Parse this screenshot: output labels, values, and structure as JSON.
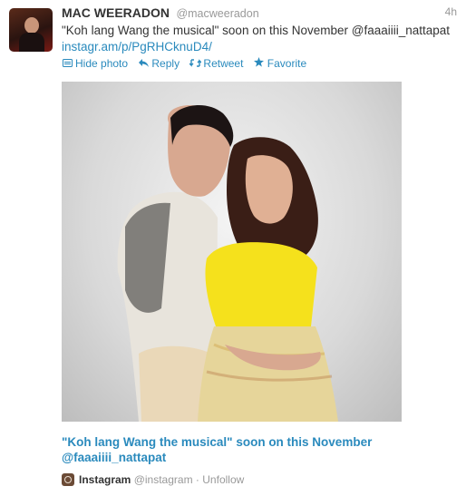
{
  "tweet": {
    "fullname": "MAC WEERADON",
    "username": "@macweeradon",
    "time": "4h",
    "text_prefix": "\"Koh lang Wang the musical\" soon on this November @faaaiiii_nattapat ",
    "text_link": "instagr.am/p/PgRHCknuD4/"
  },
  "actions": {
    "hide_photo": "Hide photo",
    "reply": "Reply",
    "retweet": "Retweet",
    "favorite": "Favorite"
  },
  "media": {
    "caption": "\"Koh lang Wang the musical\" soon on this November @faaaiiii_nattapat"
  },
  "attribution": {
    "name": "Instagram",
    "handle": "@instagram",
    "separator": "·",
    "unfollow": "Unfollow"
  },
  "colors": {
    "link": "#2a8abd",
    "muted": "#999999",
    "text": "#333333",
    "dress": "#f5e11c"
  },
  "icons": [
    "photo-icon",
    "reply-icon",
    "retweet-icon",
    "favorite-icon",
    "instagram-icon"
  ]
}
